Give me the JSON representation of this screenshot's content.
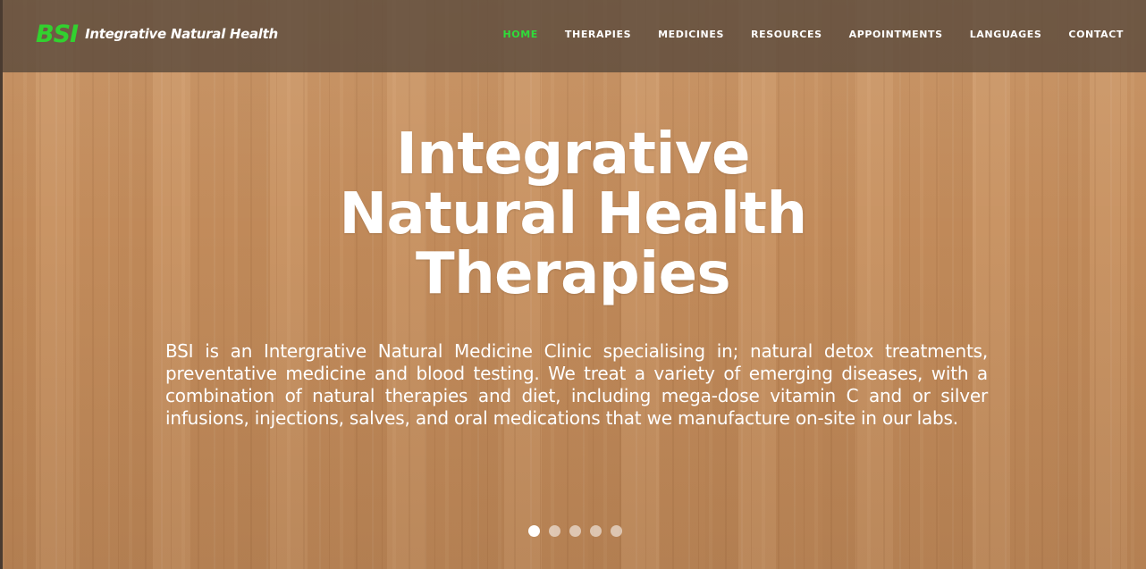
{
  "brand": {
    "mark": "BSI",
    "name": "Integrative Natural Health",
    "mark_color": "#32d12f"
  },
  "nav": {
    "items": [
      {
        "label": "HOME",
        "active": true
      },
      {
        "label": "THERAPIES",
        "active": false
      },
      {
        "label": "MEDICINES",
        "active": false
      },
      {
        "label": "RESOURCES",
        "active": false
      },
      {
        "label": "APPOINTMENTS",
        "active": false
      },
      {
        "label": "LANGUAGES",
        "active": false
      },
      {
        "label": "CONTACT",
        "active": false
      }
    ],
    "active_color": "#2fdc3a"
  },
  "hero": {
    "title_lines": [
      "Integrative",
      "Natural Health",
      "Therapies"
    ],
    "description": "BSI is an Intergrative Natural Medicine Clinic specialising in; natural detox treatments, preventative medicine and blood testing. We treat a variety of emerging diseases, with a combination of natural therapies and diet, including mega-dose vitamin C and or silver infusions, injections, salves, and oral medications that we manufacture on-site in our labs."
  },
  "slider": {
    "total": 5,
    "active_index": 0
  }
}
